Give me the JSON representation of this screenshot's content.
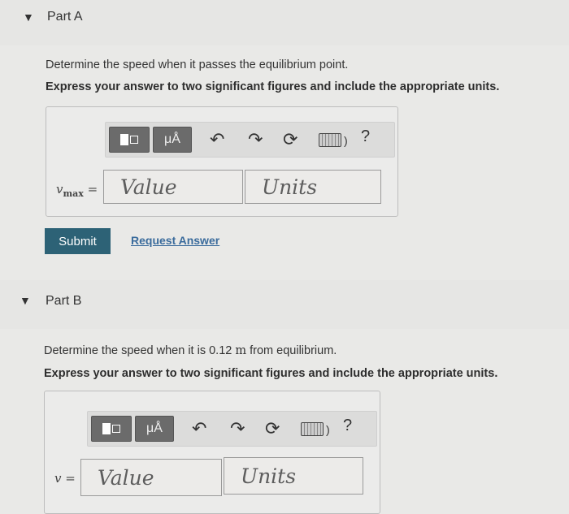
{
  "partA": {
    "title": "Part A",
    "question": "Determine the speed when it passes the equilibrium point.",
    "instruction": "Express your answer to two significant figures and include the appropriate units.",
    "variable": "v",
    "variable_sub": "max",
    "equals": "=",
    "value_placeholder": "Value",
    "units_placeholder": "Units",
    "submit_label": "Submit",
    "request_label": "Request Answer"
  },
  "partB": {
    "title": "Part B",
    "question_prefix": "Determine the speed when it is 0.12 ",
    "question_unit": "m",
    "question_suffix": " from equilibrium.",
    "instruction": "Express your answer to two significant figures and include the appropriate units.",
    "variable": "v",
    "equals": "=",
    "value_placeholder": "Value",
    "units_placeholder": "Units"
  },
  "toolbar": {
    "symbol_label": "μÅ",
    "help_label": "?",
    "keyboard_suffix": ")"
  },
  "icons": [
    "caret-down-icon",
    "templates-icon",
    "undo-icon",
    "redo-icon",
    "reset-icon",
    "keyboard-icon",
    "help-icon"
  ]
}
